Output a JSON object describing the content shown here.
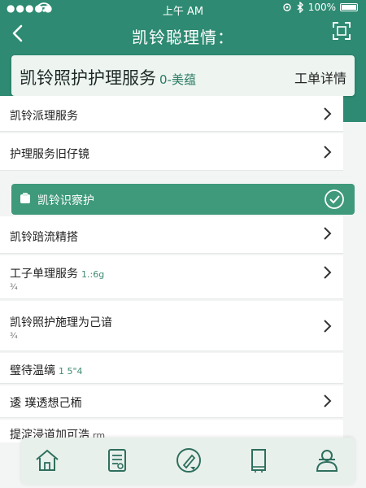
{
  "status_bar": {
    "time": "上午 AM",
    "battery": "100%"
  },
  "nav": {
    "title": "凯铃聪理情："
  },
  "header": {
    "title": "凯铃照护护理服务",
    "subtitle": "0-美蕴",
    "action": "工单详情"
  },
  "rows": [
    {
      "label": "凯铃派理服务",
      "extra": "",
      "meta": ""
    },
    {
      "label": "护理服务旧仔镜",
      "extra": "",
      "meta": ""
    },
    {
      "label": "凯铃识察护",
      "extra": "",
      "meta": ""
    },
    {
      "label": "凯铃踣流精搭",
      "extra": "",
      "meta": ""
    },
    {
      "label": "工子单理服务",
      "extra": "1.:6g",
      "meta": "¾"
    },
    {
      "label": "凯铃照护施理为己谙",
      "extra": "",
      "meta": "¾"
    },
    {
      "label": "璧待温缡",
      "extra": "1 5\"4",
      "meta": ""
    },
    {
      "label": "逶  璞透想己栭",
      "extra": "",
      "meta": ""
    },
    {
      "label": "提淀浸道加可浩",
      "extra": "rm",
      "meta": ""
    }
  ],
  "colors": {
    "brand": "#2e8a72",
    "highlight": "#3f9a7b"
  },
  "tabs": [
    "home-icon",
    "document-icon",
    "edit-icon",
    "book-icon",
    "profile-icon"
  ]
}
